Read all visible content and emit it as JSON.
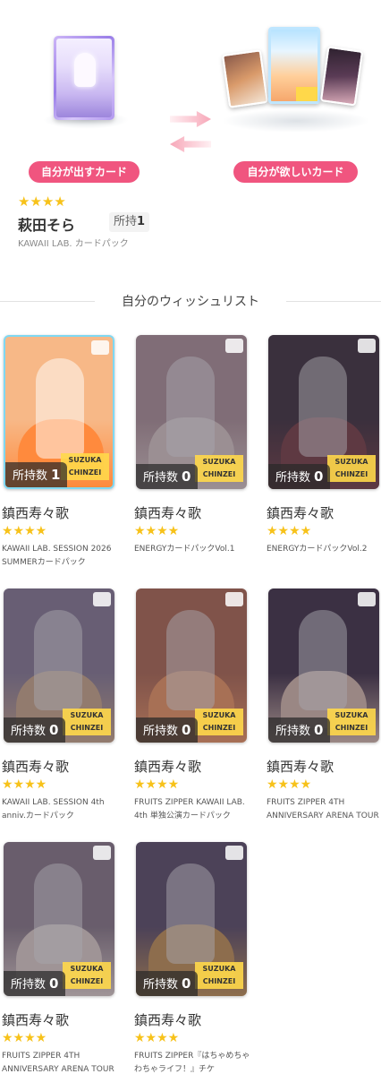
{
  "trade": {
    "give_label": "自分が出すカード",
    "want_label": "自分が欲しいカード"
  },
  "owned_card": {
    "stars": "★★★★",
    "name": "萩田そら",
    "owned_label": "所持",
    "owned_count": "1",
    "pack": "KAWAII LAB. カードパック"
  },
  "wishlist": {
    "title": "自分のウィッシュリスト",
    "count_label": "所持数",
    "items": [
      {
        "name": "鎮西寿々歌",
        "stars": "★★★★",
        "count": "1",
        "pack": "KAWAII LAB. SESSION 2026 SUMMERカードパック",
        "owned": true,
        "bg": "#f7b887",
        "dress": "#ff8a3d"
      },
      {
        "name": "鎮西寿々歌",
        "stars": "★★★★",
        "count": "0",
        "pack": "ENERGYカードパックVol.1",
        "owned": false,
        "bg": "#b89a9e",
        "dress": "#e9d7d2"
      },
      {
        "name": "鎮西寿々歌",
        "stars": "★★★★",
        "count": "0",
        "pack": "ENERGYカードパックVol.2",
        "owned": false,
        "bg": "#3a2a35",
        "dress": "#7a3b3f"
      },
      {
        "name": "鎮西寿々歌",
        "stars": "★★★★",
        "count": "0",
        "pack": "KAWAII LAB. SESSION 4th anniv.カードパック",
        "owned": false,
        "bg": "#8c7f9a",
        "dress": "#d9b38f"
      },
      {
        "name": "鎮西寿々歌",
        "stars": "★★★★",
        "count": "0",
        "pack": "FRUITS ZIPPER KAWAII LAB. 4th 単独公演カードパック",
        "owned": false,
        "bg": "#b86a4d",
        "dress": "#ff9e62"
      },
      {
        "name": "鎮西寿々歌",
        "stars": "★★★★",
        "count": "0",
        "pack": "FRUITS ZIPPER 4TH ANNIVERSARY ARENA TOUR",
        "owned": false,
        "bg": "#3b2a40",
        "dress": "#e8c9b6"
      },
      {
        "name": "鎮西寿々歌",
        "stars": "★★★★",
        "count": "0",
        "pack": "FRUITS ZIPPER 4TH ANNIVERSARY ARENA TOUR",
        "owned": false,
        "bg": "#8e7d8a",
        "dress": "#f1e0d8"
      },
      {
        "name": "鎮西寿々歌",
        "stars": "★★★★",
        "count": "0",
        "pack": "FRUITS ZIPPER『はちゃめちゃわちゃライフ！』チケ",
        "owned": false,
        "bg": "#5a4b66",
        "dress": "#d09a52"
      }
    ]
  },
  "card_name_plate": "SUZUKA CHINZEI"
}
